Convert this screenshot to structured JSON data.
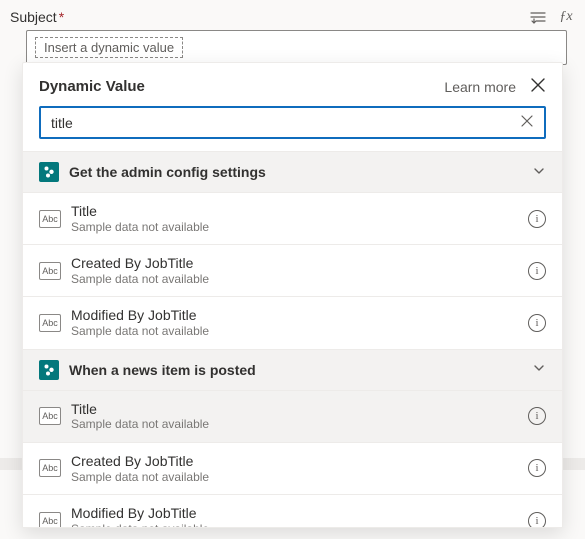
{
  "field": {
    "label": "Subject",
    "required_marker": "*",
    "placeholder": "Insert a dynamic value"
  },
  "toolbar_icons": {
    "tokens": "≡",
    "fx": "ƒx"
  },
  "dropdown": {
    "title": "Dynamic Value",
    "learn_more": "Learn more",
    "search_value": "title",
    "groups": [
      {
        "icon": "SP",
        "title": "Get the admin config settings",
        "items": [
          {
            "name": "Title",
            "sub": "Sample data not available",
            "hover": false
          },
          {
            "name": "Created By JobTitle",
            "sub": "Sample data not available",
            "hover": false
          },
          {
            "name": "Modified By JobTitle",
            "sub": "Sample data not available",
            "hover": false
          }
        ]
      },
      {
        "icon": "SP",
        "title": "When a news item is posted",
        "items": [
          {
            "name": "Title",
            "sub": "Sample data not available",
            "hover": true
          },
          {
            "name": "Created By JobTitle",
            "sub": "Sample data not available",
            "hover": false
          },
          {
            "name": "Modified By JobTitle",
            "sub": "Sample data not available",
            "hover": false
          }
        ]
      }
    ]
  }
}
